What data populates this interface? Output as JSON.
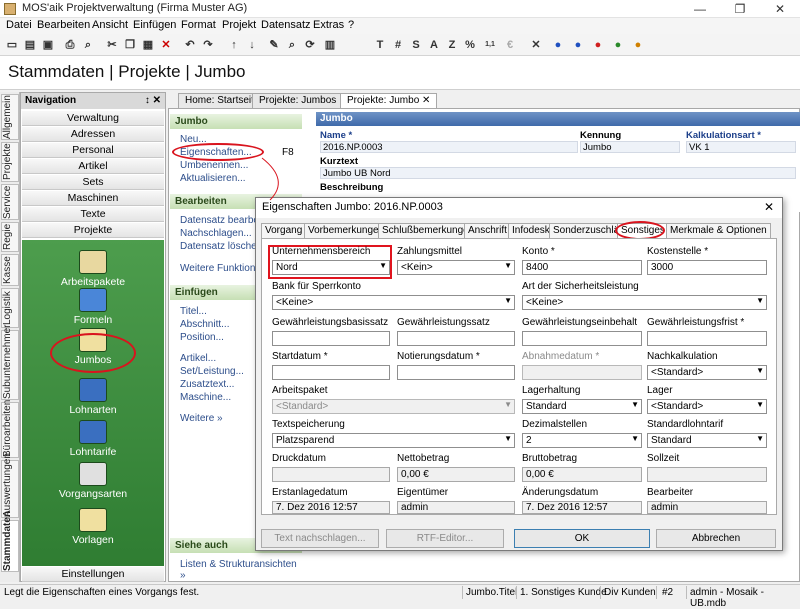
{
  "window": {
    "title": "MOS'aik Projektverwaltung (Firma Muster AG)",
    "min": "—",
    "restore": "❐",
    "close": "✕"
  },
  "menu": [
    "Datei",
    "Bearbeiten",
    "Ansicht",
    "Einfügen",
    "Format",
    "Projekt",
    "Datensatz",
    "Extras",
    "?"
  ],
  "toolbar": {
    "text_buttons": [
      "T",
      "#",
      "S",
      "A",
      "Z",
      "%"
    ]
  },
  "header": {
    "title": "Stammdaten | Projekte | Jumbo"
  },
  "vtabs": [
    "Allgemein",
    "Projekte",
    "Service",
    "Regie",
    "Kasse",
    "Logistik",
    "Subunternehmer",
    "Büroarbeiten",
    "Auswertungen",
    "Stammdaten"
  ],
  "nav": {
    "title": "Navigation",
    "pin": "↕ ✕",
    "buttons": [
      "Verwaltung",
      "Adressen",
      "Personal",
      "Artikel",
      "Sets",
      "Maschinen",
      "Texte",
      "Projekte"
    ],
    "items": [
      "Arbeitspakete",
      "Formeln",
      "Jumbos",
      "Lohnarten",
      "Lohntarife",
      "Vorgangsarten",
      "Vorlagen"
    ],
    "bottom": "Einstellungen"
  },
  "doctabs": [
    "Home: Startseite",
    "Projekte: Jumbos",
    "Projekte: Jumbo ✕"
  ],
  "actions": {
    "jumbo_header": "Jumbo",
    "jumbo_links": [
      "Neu...",
      "Eigenschaften...",
      "Umbenennen...",
      "Aktualisieren..."
    ],
    "shortcut": "F8",
    "bearbeiten_header": "Bearbeiten",
    "bearbeiten_links": [
      "Datensatz bearbeit",
      "Nachschlagen...",
      "Datensatz löschen"
    ],
    "weitere_funktionen": "Weitere Funktionen",
    "einfuegen_header": "Einfügen",
    "einfuegen_links": [
      "Titel...",
      "Abschnitt...",
      "Position...",
      "Artikel...",
      "Set/Leistung...",
      "Zusatztext...",
      "Maschine..."
    ],
    "weitere": "Weitere »",
    "siehe_header": "Siehe auch",
    "siehe_link": "Listen & Strukturansichten »"
  },
  "record": {
    "header": "Jumbo",
    "name_label": "Name *",
    "name_value": "2016.NP.0003",
    "kennung_label": "Kennung",
    "kennung_value": "Jumbo",
    "kalk_label": "Kalkulationsart *",
    "kalk_value": "VK 1",
    "kurztext_label": "Kurztext",
    "kurztext_value": "Jumbo UB Nord",
    "beschreibung_label": "Beschreibung"
  },
  "dialog": {
    "title": "Eigenschaften Jumbo: 2016.NP.0003",
    "tabs": [
      "Vorgang",
      "Vorbemerkungen",
      "Schlußbemerkungen",
      "Anschrift",
      "Infodesk",
      "Sonderzuschläge",
      "Sonstiges",
      "Merkmale & Optionen"
    ],
    "fields": {
      "unternehmensbereich": {
        "label": "Unternehmensbereich",
        "value": "Nord"
      },
      "zahlungsmittel": {
        "label": "Zahlungsmittel",
        "value": "<Kein>"
      },
      "konto": {
        "label": "Konto *",
        "value": "8400"
      },
      "kostenstelle": {
        "label": "Kostenstelle *",
        "value": "3000"
      },
      "bank": {
        "label": "Bank für Sperrkonto",
        "value": "<Keine>"
      },
      "sicherheit": {
        "label": "Art der Sicherheitsleistung",
        "value": "<Keine>"
      },
      "gw_basis": {
        "label": "Gewährleistungsbasissatz",
        "value": ""
      },
      "gw_satz": {
        "label": "Gewährleistungssatz",
        "value": ""
      },
      "gw_einheit": {
        "label": "Gewährleistungseinbehalt",
        "value": ""
      },
      "gw_frist": {
        "label": "Gewährleistungsfrist *",
        "value": ""
      },
      "startdatum": {
        "label": "Startdatum *",
        "value": ""
      },
      "notierung": {
        "label": "Notierungsdatum *",
        "value": ""
      },
      "abnahme": {
        "label": "Abnahmedatum *",
        "value": ""
      },
      "nachkalk": {
        "label": "Nachkalkulation",
        "value": "<Standard>"
      },
      "arbeitspaket": {
        "label": "Arbeitspaket",
        "value": "<Standard>"
      },
      "lagerhaltung": {
        "label": "Lagerhaltung",
        "value": "Standard"
      },
      "lager": {
        "label": "Lager",
        "value": "<Standard>"
      },
      "textspeicherung": {
        "label": "Textspeicherung",
        "value": "Platzsparend"
      },
      "dezimal": {
        "label": "Dezimalstellen",
        "value": "2"
      },
      "lohntarif": {
        "label": "Standardlohntarif",
        "value": "Standard"
      },
      "druckdatum": {
        "label": "Druckdatum",
        "value": ""
      },
      "netto": {
        "label": "Nettobetrag",
        "value": "0,00 €"
      },
      "brutto": {
        "label": "Bruttobetrag",
        "value": "0,00 €"
      },
      "soll": {
        "label": "Sollzeit",
        "value": ""
      },
      "erstanlage": {
        "label": "Erstanlagedatum",
        "value": "7. Dez 2016 12:57"
      },
      "eigentuemer": {
        "label": "Eigentümer",
        "value": "admin"
      },
      "aenderung": {
        "label": "Änderungsdatum",
        "value": "7. Dez 2016 12:57"
      },
      "bearbeiter": {
        "label": "Bearbeiter",
        "value": "admin"
      }
    },
    "buttons": {
      "text_lookup": "Text nachschlagen...",
      "rtf": "RTF-Editor...",
      "ok": "OK",
      "cancel": "Abbrechen"
    }
  },
  "status": {
    "message": "Legt die Eigenschaften eines Vorgangs fest.",
    "cells": [
      "Jumbo.Titel",
      "1. Sonstiges Kunde",
      "Div Kunden",
      "#2",
      "admin - Mosaik - UB.mdb"
    ]
  },
  "colors": {
    "accent_red": "#e0141e",
    "nav_green": "#3b8a3d",
    "record_blue": "#3f6aaa"
  }
}
